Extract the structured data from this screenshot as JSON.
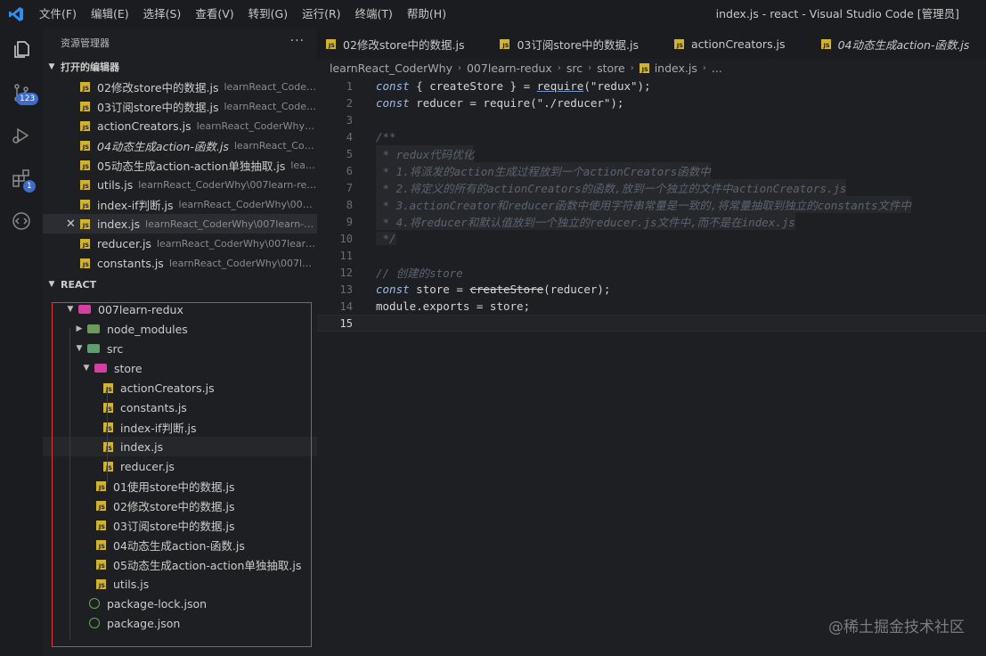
{
  "titlebar": {
    "menu": [
      "文件(F)",
      "编辑(E)",
      "选择(S)",
      "查看(V)",
      "转到(G)",
      "运行(R)",
      "终端(T)",
      "帮助(H)"
    ],
    "window_title": "index.js - react - Visual Studio Code [管理员]"
  },
  "activitybar": {
    "scm_badge": "123",
    "ext_badge": "1"
  },
  "sidebar": {
    "header": "资源管理器",
    "more": "···",
    "open_editors_title": "打开的编辑器",
    "open_editors": [
      {
        "name": "02修改store中的数据.js",
        "path": "learnReact_Coder..."
      },
      {
        "name": "03订阅store中的数据.js",
        "path": "learnReact_Coder..."
      },
      {
        "name": "actionCreators.js",
        "path": "learnReact_CoderWhy\\00..."
      },
      {
        "name": "04动态生成action-函数.js",
        "path": "learnReact_Cod..."
      },
      {
        "name": "05动态生成action-action单独抽取.js",
        "path": "lear..."
      },
      {
        "name": "utils.js",
        "path": "learnReact_CoderWhy\\007learn-redu..."
      },
      {
        "name": "index-if判断.js",
        "path": "learnReact_CoderWhy\\007l..."
      },
      {
        "name": "index.js",
        "path": "learnReact_CoderWhy\\007learn-re..."
      },
      {
        "name": "reducer.js",
        "path": "learnReact_CoderWhy\\007learn-..."
      },
      {
        "name": "constants.js",
        "path": "learnReact_CoderWhy\\007learn..."
      }
    ],
    "react_title": "REACT",
    "tree": {
      "root": "007learn-redux",
      "node_modules": "node_modules",
      "src": "src",
      "store": "store",
      "store_files": [
        "actionCreators.js",
        "constants.js",
        "index-if判断.js",
        "index.js",
        "reducer.js"
      ],
      "src_files": [
        "01使用store中的数据.js",
        "02修改store中的数据.js",
        "03订阅store中的数据.js",
        "04动态生成action-函数.js",
        "05动态生成action-action单独抽取.js",
        "utils.js"
      ],
      "json_files": [
        "package-lock.json",
        "package.json"
      ]
    }
  },
  "tabs": [
    {
      "label": "02修改store中的数据.js"
    },
    {
      "label": "03订阅store中的数据.js"
    },
    {
      "label": "actionCreators.js"
    },
    {
      "label": "04动态生成action-函数.js"
    }
  ],
  "breadcrumb": [
    "learnReact_CoderWhy",
    "007learn-redux",
    "src",
    "store",
    "index.js",
    "..."
  ],
  "editor": {
    "line_numbers": [
      "1",
      "2",
      "3",
      "4",
      "5",
      "6",
      "7",
      "8",
      "9",
      "10",
      "11",
      "12",
      "13",
      "14",
      "15"
    ],
    "comment_lines": [
      "/**",
      " * redux代码优化",
      " * 1.将派发的action生成过程放到一个actionCreators函数中",
      " * 2.将定义的所有的actionCreators的函数,放到一个独立的文件中actionCreators.js",
      " * 3.actionCreator和reducer函数中使用字符串常量是一致的,将常量抽取到独立的constants文件中",
      " * 4.将reducer和默认值放到一个独立的reducer.js文件中,而不是在index.js",
      " */"
    ],
    "line12": "// 创建的store"
  },
  "watermark": "@稀土掘金技术社区"
}
